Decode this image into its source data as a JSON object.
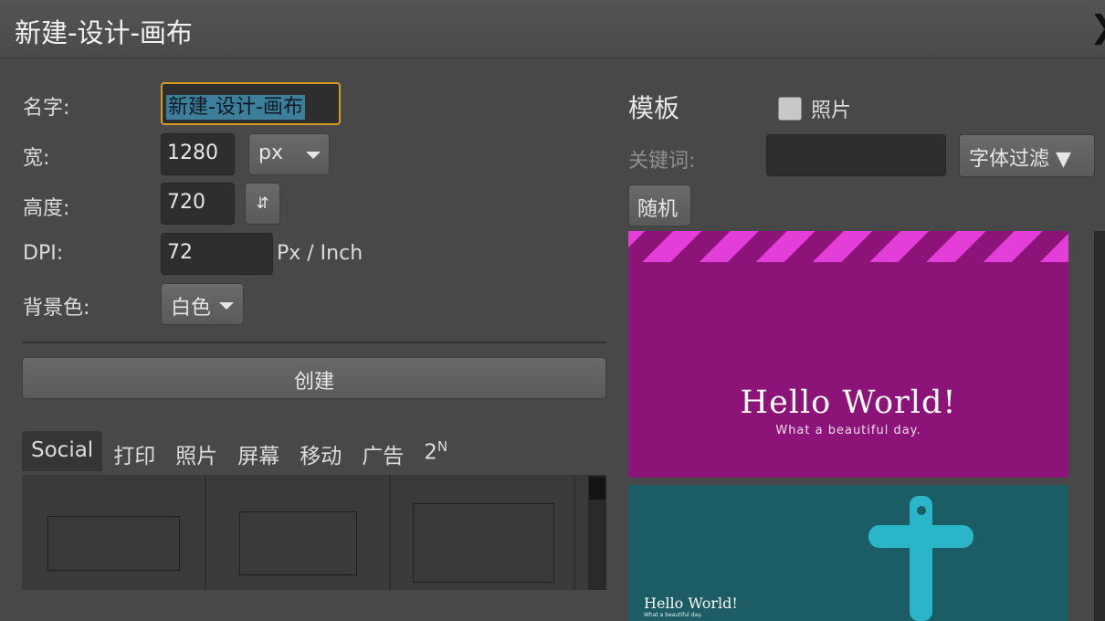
{
  "window": {
    "title": "新建-设计-画布",
    "close_label": "❯"
  },
  "form": {
    "name_label": "名字:",
    "name_value": "新建-设计-画布",
    "width_label": "宽:",
    "width_value": "1280",
    "unit_value": "px",
    "height_label": "高度:",
    "height_value": "720",
    "swap_icon": "⇵",
    "dpi_label": "DPI:",
    "dpi_value": "72",
    "dpi_unit": "Px / Inch",
    "bg_label": "背景色:",
    "bg_value": "白色",
    "create_label": "创建"
  },
  "categories": {
    "tabs": [
      {
        "label": "Social",
        "active": true
      },
      {
        "label": "打印",
        "active": false
      },
      {
        "label": "照片",
        "active": false
      },
      {
        "label": "屏幕",
        "active": false
      },
      {
        "label": "移动",
        "active": false
      },
      {
        "label": "广告",
        "active": false
      },
      {
        "label": "2",
        "sup": "N",
        "active": false
      }
    ]
  },
  "templates": {
    "title": "模板",
    "photo_label": "照片",
    "photo_checked": false,
    "keyword_label": "关键词:",
    "keyword_value": "",
    "font_filter_label": "字体过滤 ▼",
    "random_label": "随机",
    "items": [
      {
        "heading": "Hello World!",
        "subheading": "What a beautiful day.",
        "bg_color": "#8c1478",
        "stripe_color": "#e43ed8"
      },
      {
        "heading": "Hello World!",
        "subheading": "What a beautiful day.",
        "bg_color": "#1c5c64",
        "accent_color": "#2bb5c8"
      }
    ]
  }
}
